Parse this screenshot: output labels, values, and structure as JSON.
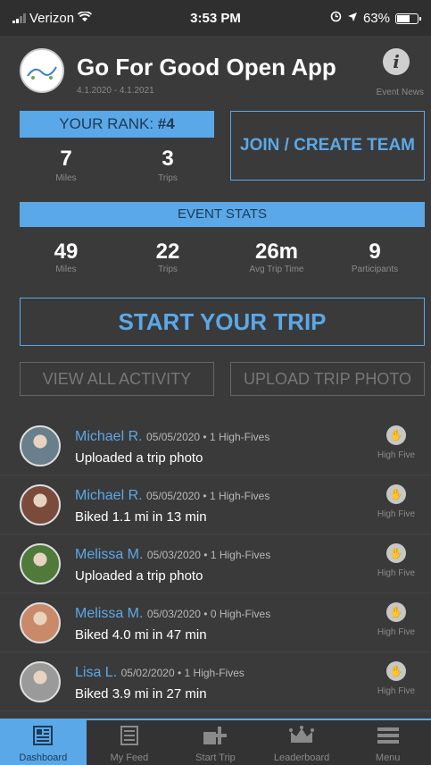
{
  "status": {
    "carrier": "Verizon",
    "time": "3:53 PM",
    "battery": "63%",
    "battery_fraction": 0.63
  },
  "header": {
    "logo_text": "GoforGood",
    "title": "Go For Good Open App",
    "dates": "4.1.2020 - 4.1.2021",
    "info_label": "Event News"
  },
  "rank": {
    "label": "YOUR RANK:",
    "value": "#4"
  },
  "your_stats": [
    {
      "value": "7",
      "label": "Miles"
    },
    {
      "value": "3",
      "label": "Trips"
    }
  ],
  "join_button": "JOIN / CREATE TEAM",
  "event_stats_title": "EVENT STATS",
  "event_stats": [
    {
      "value": "49",
      "label": "Miles"
    },
    {
      "value": "22",
      "label": "Trips"
    },
    {
      "value": "26m",
      "label": "Avg Trip Time"
    },
    {
      "value": "9",
      "label": "Participants"
    }
  ],
  "start_button": "START YOUR TRIP",
  "view_button": "VIEW ALL ACTIVITY",
  "upload_button": "UPLOAD TRIP PHOTO",
  "feed": [
    {
      "name": "Michael R.",
      "meta": "05/05/2020 • 1 High-Fives",
      "text": "Uploaded a trip photo",
      "hf_label": "High Five",
      "avatar_color": "#6a7f8c"
    },
    {
      "name": "Michael R.",
      "meta": "05/05/2020 • 1 High-Fives",
      "text": "Biked 1.1 mi in 13 min",
      "hf_label": "High Five",
      "avatar_color": "#7a4a3a"
    },
    {
      "name": "Melissa M.",
      "meta": "05/03/2020 • 1 High-Fives",
      "text": "Uploaded a trip photo",
      "hf_label": "High Five",
      "avatar_color": "#4f7a3a"
    },
    {
      "name": "Melissa M.",
      "meta": "05/03/2020 • 0 High-Fives",
      "text": "Biked 4.0 mi in 47 min",
      "hf_label": "High Five",
      "avatar_color": "#c98a6a"
    },
    {
      "name": "Lisa L.",
      "meta": "05/02/2020 • 1 High-Fives",
      "text": "Biked 3.9 mi in 27 min",
      "hf_label": "High Five",
      "avatar_color": "#9a9a9a"
    }
  ],
  "tabs": [
    {
      "label": "Dashboard",
      "icon": "dashboard-icon"
    },
    {
      "label": "My Feed",
      "icon": "feed-icon"
    },
    {
      "label": "Start Trip",
      "icon": "start-trip-icon"
    },
    {
      "label": "Leaderboard",
      "icon": "crown-icon"
    },
    {
      "label": "Menu",
      "icon": "menu-icon"
    }
  ],
  "colors": {
    "accent": "#5ba8e8",
    "background": "#3a3a3a"
  }
}
